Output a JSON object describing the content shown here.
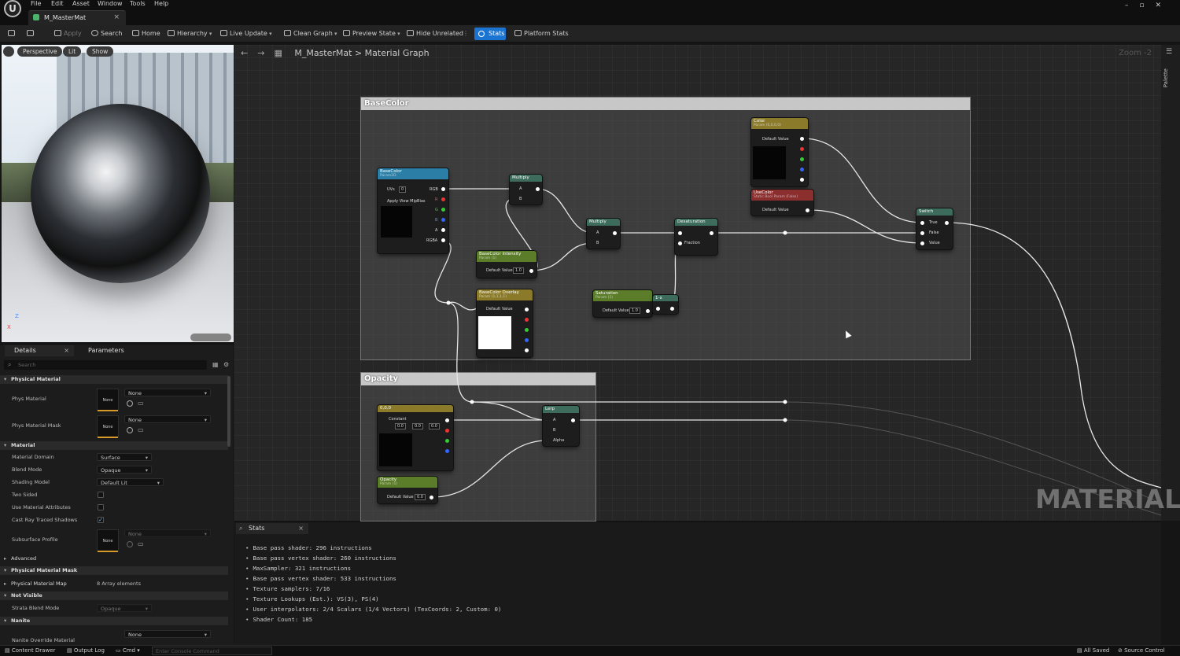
{
  "menu": [
    "File",
    "Edit",
    "Asset",
    "Window",
    "Tools",
    "Help"
  ],
  "document_tab": "M_MasterMat",
  "toolbar": {
    "apply": "Apply",
    "search": "Search",
    "home": "Home",
    "hierarchy": "Hierarchy",
    "live_update": "Live Update",
    "clean_graph": "Clean Graph",
    "preview_state": "Preview State",
    "hide_unrelated": "Hide Unrelated",
    "stats": "Stats",
    "platform_stats": "Platform Stats"
  },
  "viewport": {
    "perspective": "Perspective",
    "lit": "Lit",
    "show": "Show",
    "axis_z": "Z",
    "axis_x": "X"
  },
  "graph": {
    "breadcrumb_root": "M_MasterMat",
    "breadcrumb_sep": ">",
    "breadcrumb_leaf": "Material Graph",
    "zoom": "Zoom -2",
    "palette": "Palette",
    "watermark": "MATERIAL",
    "comments": {
      "basecolor": "BaseColor",
      "opacity": "Opacity"
    },
    "nodes": {
      "basecolor_tex": {
        "title": "BaseColor",
        "sub": "Param2D",
        "uv": "UVs",
        "uv_val": "0",
        "pins": [
          "RGB",
          "R",
          "G",
          "B",
          "A",
          "RGBA"
        ],
        "mip": "Apply View MipBias"
      },
      "multiply1": {
        "title": "Multiply",
        "a": "A",
        "b": "B"
      },
      "multiply2": {
        "title": "Multiply",
        "a": "A",
        "b": "B"
      },
      "intensity": {
        "title": "BaseColor Intensity",
        "sub": "Param (1)",
        "label": "Default Value",
        "value": "1.0"
      },
      "overlay": {
        "title": "BaseColor Overlay",
        "sub": "Param (1,1,1,1)",
        "label": "Default Value"
      },
      "saturation": {
        "title": "Saturation",
        "sub": "Param (1)",
        "label": "Default Value",
        "value": "1.0"
      },
      "one_minus": {
        "title": "1-x"
      },
      "desaturation": {
        "title": "Desaturation",
        "fraction": "Fraction"
      },
      "color": {
        "title": "Color",
        "sub": "Param (0,0,0,0)",
        "label": "Default Value"
      },
      "usecolor": {
        "title": "UseColor",
        "sub": "Static Bool Param (False)",
        "label": "Default Value"
      },
      "switch": {
        "title": "Switch",
        "true": "True",
        "false": "False",
        "value": "Value"
      },
      "opacity_const": {
        "title": "0,0,0",
        "label": "Constant",
        "v1": "0.0",
        "v2": "0.0",
        "v3": "0.0"
      },
      "lerp": {
        "title": "Lerp",
        "a": "A",
        "b": "B",
        "alpha": "Alpha"
      },
      "opacity_param": {
        "title": "Opacity",
        "sub": "Param (1)",
        "label": "Default Value",
        "value": "0.0"
      }
    }
  },
  "details": {
    "tab_details": "Details",
    "tab_parameters": "Parameters",
    "search_placeholder": "Search",
    "sections": {
      "physical_material": "Physical Material",
      "material": "Material",
      "advanced": "Advanced",
      "physical_material_mask": "Physical Material Mask",
      "not_visible": "Not Visible",
      "nanite": "Nanite"
    },
    "rows": {
      "phys_material": "Phys Material",
      "phys_material_mask": "Phys Material Mask",
      "material_domain": "Material Domain",
      "blend_mode": "Blend Mode",
      "shading_model": "Shading Model",
      "two_sided": "Two Sided",
      "use_material_attributes": "Use Material Attributes",
      "cast_ray_traced_shadows": "Cast Ray Traced Shadows",
      "subsurface_profile": "Subsurface Profile",
      "physical_material_map": "Physical Material Map",
      "strata_blend_mode": "Strata Blend Mode",
      "nanite_override_material": "Nanite Override Material"
    },
    "values": {
      "none": "None",
      "material_domain": "Surface",
      "blend_mode": "Opaque",
      "shading_model": "Default Lit",
      "physical_material_map": "8 Array elements",
      "strata_blend_mode": "Opaque"
    }
  },
  "stats": {
    "tab": "Stats",
    "lines": [
      "Base pass shader: 296 instructions",
      "Base pass vertex shader: 260 instructions",
      "MaxSampler: 321 instructions",
      "Base pass vertex shader: 533 instructions",
      "Texture samplers: 7/16",
      "Texture Lookups (Est.): VS(3), PS(4)",
      "User interpolators: 2/4 Scalars (1/4 Vectors) (TexCoords: 2, Custom: 0)",
      "Shader Count: 185"
    ]
  },
  "statusbar": {
    "content_drawer": "Content Drawer",
    "output_log": "Output Log",
    "cmd": "Cmd",
    "console_placeholder": "Enter Console Command",
    "all_saved": "All Saved",
    "source_control": "Source Control"
  },
  "colors": {
    "accent": "#1b74d1",
    "texture_header": "#2b7fa6",
    "math_header": "#3d6b5c",
    "param_header": "#5b7d2a",
    "vector_param_header": "#8a7a2a",
    "bool_header": "#8a2e2e"
  }
}
